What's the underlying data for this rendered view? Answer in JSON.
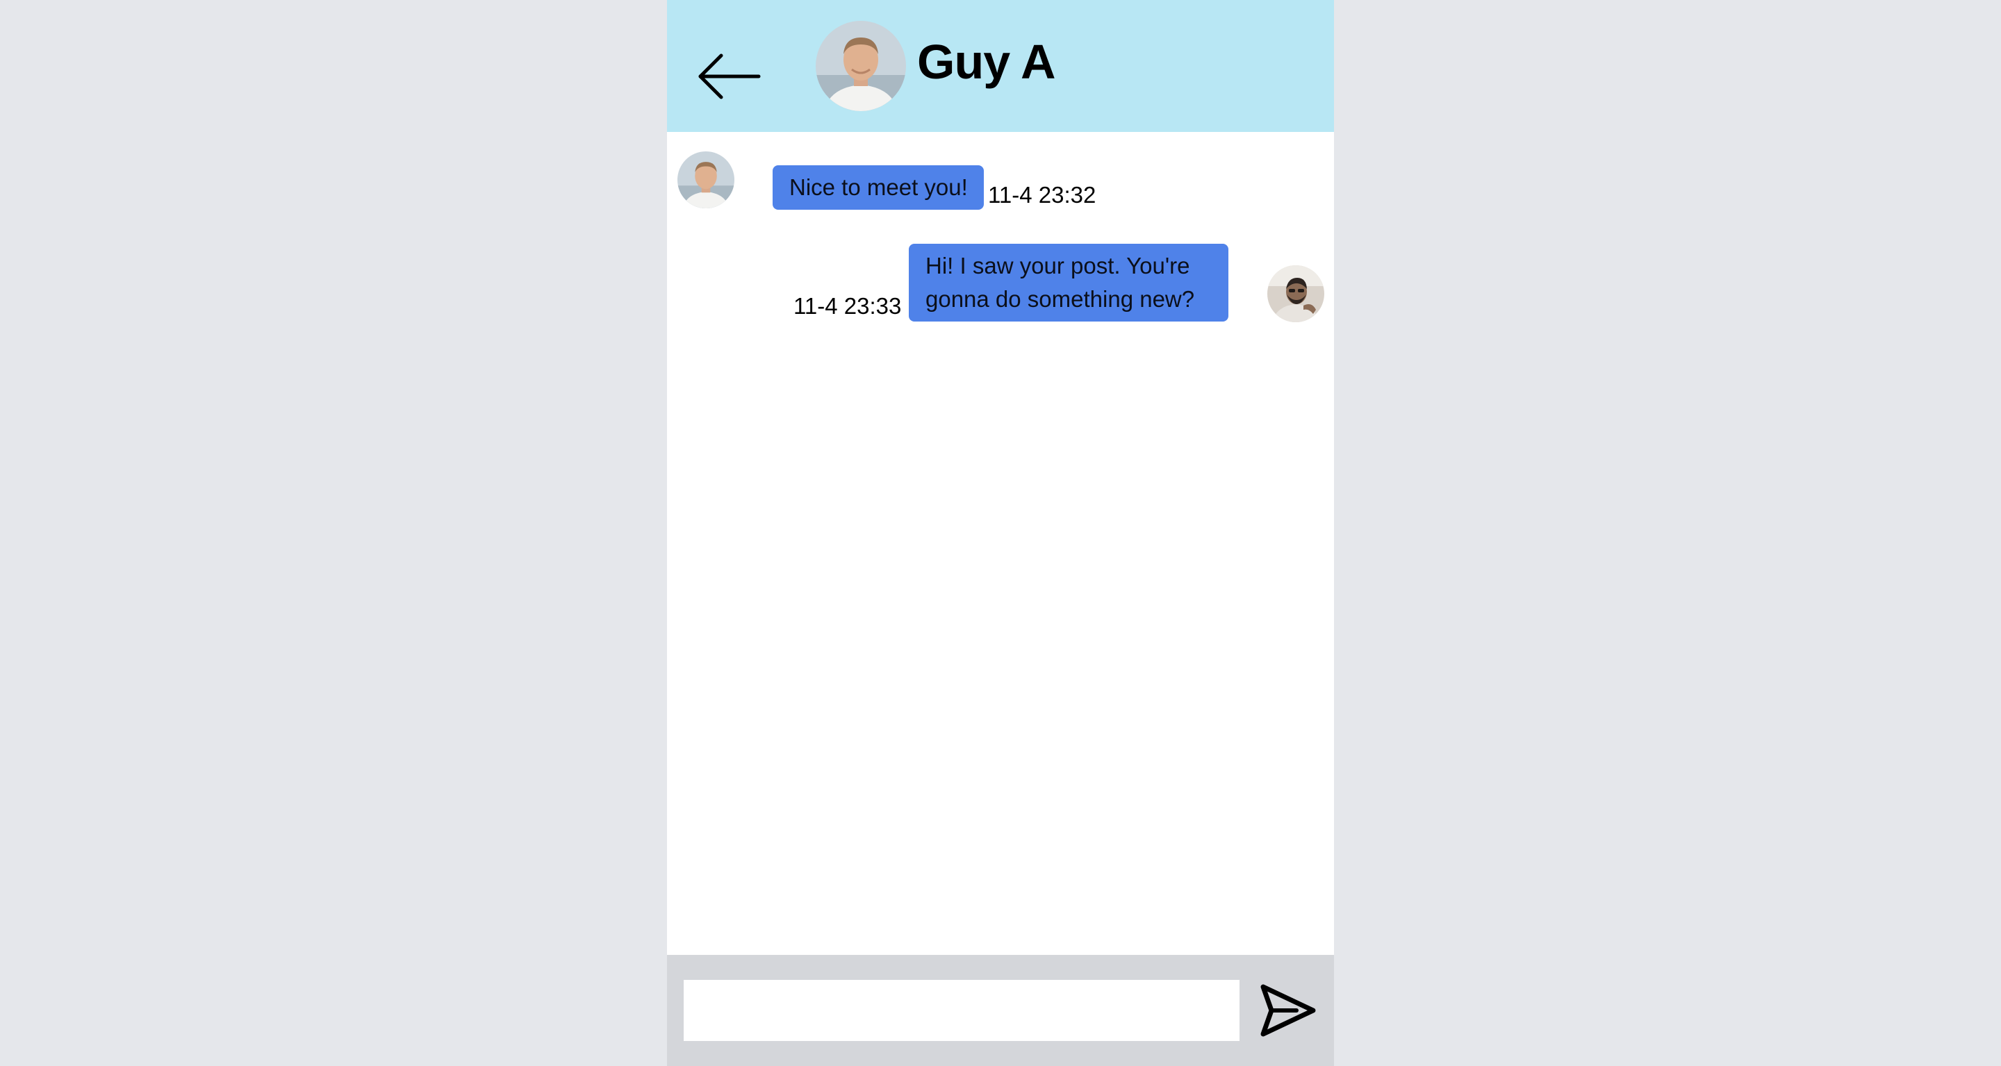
{
  "header": {
    "contact_name": "Guy A"
  },
  "messages": [
    {
      "sender": "contact",
      "text": "Nice to meet you!",
      "time": "11-4 23:32"
    },
    {
      "sender": "me",
      "line1": "Hi! I saw your post. You're",
      "line2": "gonna do something new?",
      "time": "11-4 23:33"
    }
  ],
  "composer": {
    "placeholder": "",
    "value": ""
  },
  "colors": {
    "page_bg": "#e5e7eb",
    "header_bg": "#b8e7f4",
    "bubble": "#4f82e9",
    "footer_bg": "#d4d6da"
  },
  "icons": {
    "back": "arrow-left-icon",
    "send": "send-icon"
  }
}
